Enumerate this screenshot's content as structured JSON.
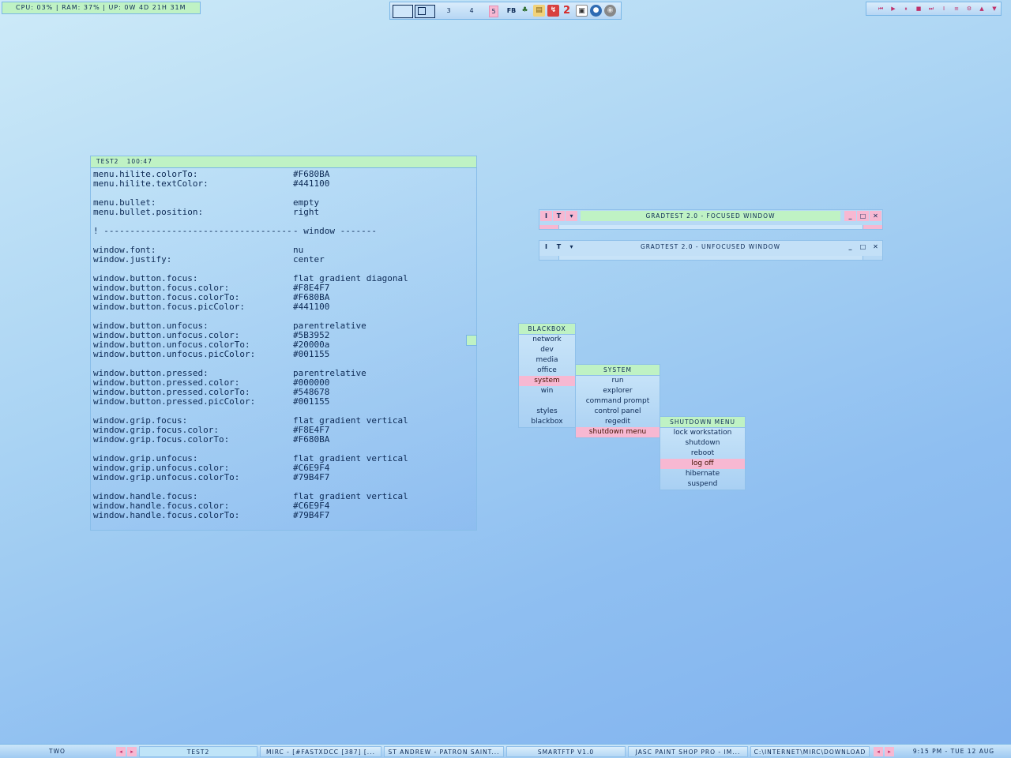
{
  "system_stats": {
    "text": "CPU: 03% | RAM: 37% | UP: 0W 4D 21H 31M"
  },
  "pager": {
    "desktops": [
      "3",
      "4",
      "5"
    ],
    "tray_icons": [
      "fb-icon",
      "network-icon",
      "folder-icon",
      "app-icon",
      "2-icon",
      "floppy-icon",
      "globe-icon",
      "disc-icon"
    ]
  },
  "media": {
    "buttons": [
      "⏮",
      "▶",
      "⏸",
      "■",
      "⏭",
      "I",
      "≡",
      "⚙",
      "▲",
      "▼"
    ]
  },
  "terminal": {
    "title": "TEST2   100:47",
    "lines": [
      [
        "menu.hilite.colorTo:",
        "#F680BA"
      ],
      [
        "menu.hilite.textColor:",
        "#441100"
      ],
      [
        "",
        ""
      ],
      [
        "menu.bullet:",
        "empty"
      ],
      [
        "menu.bullet.position:",
        "right"
      ],
      [
        "",
        ""
      ],
      [
        "! ---------------------------------------",
        "- window -------"
      ],
      [
        "",
        ""
      ],
      [
        "window.font:",
        "nu"
      ],
      [
        "window.justify:",
        "center"
      ],
      [
        "",
        ""
      ],
      [
        "window.button.focus:",
        "flat gradient diagonal"
      ],
      [
        "window.button.focus.color:",
        "#F8E4F7"
      ],
      [
        "window.button.focus.colorTo:",
        "#F680BA"
      ],
      [
        "window.button.focus.picColor:",
        "#441100"
      ],
      [
        "",
        ""
      ],
      [
        "window.button.unfocus:",
        "parentrelative"
      ],
      [
        "window.button.unfocus.color:",
        "#5B3952"
      ],
      [
        "window.button.unfocus.colorTo:",
        "#20000a"
      ],
      [
        "window.button.unfocus.picColor:",
        "#001155"
      ],
      [
        "",
        ""
      ],
      [
        "window.button.pressed:",
        "parentrelative"
      ],
      [
        "window.button.pressed.color:",
        "#000000"
      ],
      [
        "window.button.pressed.colorTo:",
        "#548678"
      ],
      [
        "window.button.pressed.picColor:",
        "#001155"
      ],
      [
        "",
        ""
      ],
      [
        "window.grip.focus:",
        "flat gradient vertical"
      ],
      [
        "window.grip.focus.color:",
        "#F8E4F7"
      ],
      [
        "window.grip.focus.colorTo:",
        "#F680BA"
      ],
      [
        "",
        ""
      ],
      [
        "window.grip.unfocus:",
        "flat gradient vertical"
      ],
      [
        "window.grip.unfocus.color:",
        "#C6E9F4"
      ],
      [
        "window.grip.unfocus.colorTo:",
        "#79B4F7"
      ],
      [
        "",
        ""
      ],
      [
        "window.handle.focus:",
        "flat gradient vertical"
      ],
      [
        "window.handle.focus.color:",
        "#C6E9F4"
      ],
      [
        "window.handle.focus.colorTo:",
        "#79B4F7"
      ]
    ]
  },
  "windows": {
    "focused": {
      "title": "GRADTEST 2.0 - FOCUSED WINDOW",
      "btn_left": [
        "I",
        "T",
        "▾"
      ],
      "btn_right": [
        "_",
        "□",
        "✕"
      ]
    },
    "unfocused": {
      "title": "GRADTEST 2.0 - UNFOCUSED WINDOW",
      "btn_left": [
        "I",
        "T",
        "▾"
      ],
      "btn_right": [
        "_",
        "□",
        "✕"
      ]
    }
  },
  "menus": {
    "blackbox": {
      "title": "BLACKBOX",
      "items": [
        "network",
        "dev",
        "media",
        "office",
        "system",
        "win",
        "",
        "styles",
        "blackbox"
      ],
      "highlight": "system"
    },
    "system": {
      "title": "SYSTEM",
      "items": [
        "run",
        "explorer",
        "command prompt",
        "control panel",
        "regedit",
        "shutdown menu"
      ],
      "highlight": "shutdown menu"
    },
    "shutdown": {
      "title": "SHUTDOWN MENU",
      "items": [
        "lock workstation",
        "shutdown",
        "reboot",
        "log off",
        "hibernate",
        "suspend"
      ],
      "highlight": "log off"
    }
  },
  "taskbar": {
    "workspace": "TWO",
    "tasks": [
      "TEST2",
      "MIRC - [#FASTXDCC [387] [...",
      "ST ANDREW - PATRON SAINT...",
      "SMARTFTP V1.0",
      "JASC PAINT SHOP PRO - IM...",
      "C:\\INTERNET\\MIRC\\DOWNLOAD"
    ],
    "clock": "9:15 PM - TUE 12 AUG"
  },
  "colors": {
    "pink": "#F7B8D2",
    "green": "#BFF2C4",
    "text": "#0D2A55"
  }
}
